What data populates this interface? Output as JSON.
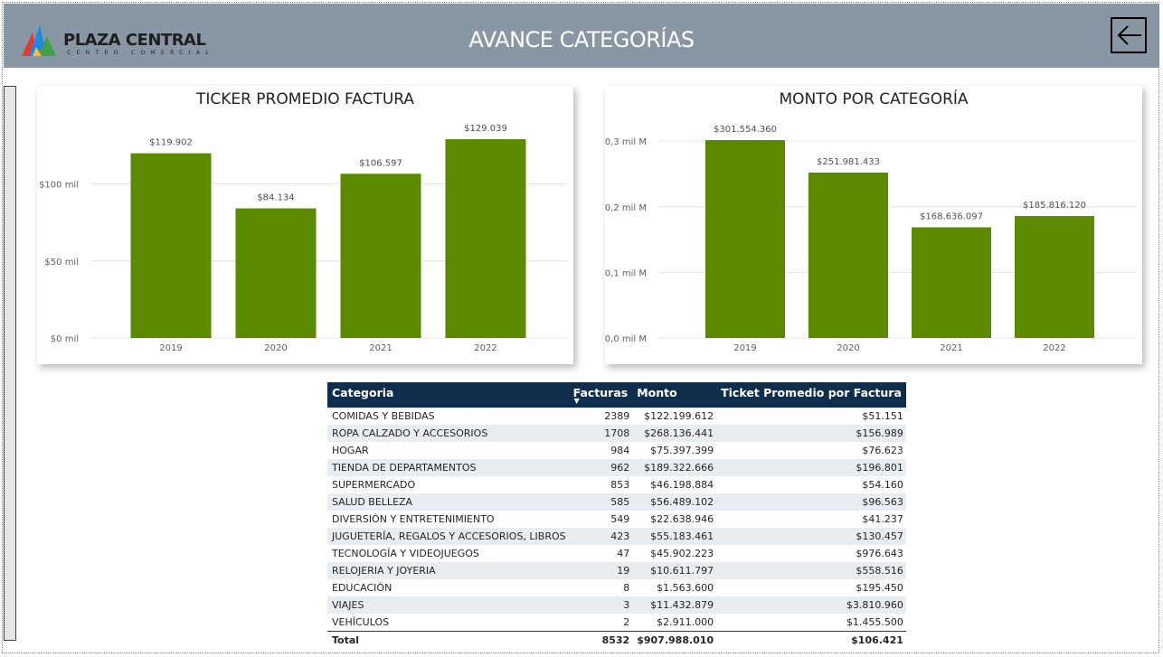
{
  "header": {
    "title": "AVANCE CATEGORÍAS",
    "logo": {
      "name": "PLAZA CENTRAL",
      "tagline": "CENTRO COMERCIAL",
      "colors": [
        "#e53935",
        "#1e88e5",
        "#43a047",
        "#fbc02d"
      ]
    },
    "back_icon": "arrow-left-icon"
  },
  "colors": {
    "header_bg": "#8996a3",
    "bar": "#5b8a00",
    "table_header": "#0f2d4d",
    "row_alt": "#e8edf1"
  },
  "chart_data": [
    {
      "type": "bar",
      "title": "TICKER PROMEDIO FACTURA",
      "categories": [
        "2019",
        "2020",
        "2021",
        "2022"
      ],
      "values": [
        119902,
        84134,
        106597,
        129039
      ],
      "data_labels": [
        "$119.902",
        "$84.134",
        "$106.597",
        "$129.039"
      ],
      "yticks": [
        {
          "value": 0,
          "label": "$0 mil"
        },
        {
          "value": 50000,
          "label": "$50 mil"
        },
        {
          "value": 100000,
          "label": "$100 mil"
        }
      ],
      "ylim": [
        0,
        129039
      ],
      "grid": true
    },
    {
      "type": "bar",
      "title": "MONTO POR CATEGORÍA",
      "categories": [
        "2019",
        "2020",
        "2021",
        "2022"
      ],
      "values": [
        301554360,
        251981433,
        168636097,
        185816120
      ],
      "data_labels": [
        "$301.554.360",
        "$251.981.433",
        "$168.636.097",
        "$185.816.120"
      ],
      "yticks": [
        {
          "value": 0,
          "label": "$0,0 mil M"
        },
        {
          "value": 100000000,
          "label": "$0,1 mil M"
        },
        {
          "value": 200000000,
          "label": "$0,2 mil M"
        },
        {
          "value": 300000000,
          "label": "$0,3 mil M"
        }
      ],
      "ylim": [
        0,
        301554360
      ],
      "grid": true
    }
  ],
  "table": {
    "columns": [
      "Categoria",
      "Facturas",
      "Monto",
      "Ticket Promedio por Factura"
    ],
    "rows": [
      [
        "COMIDAS Y BEBIDAS",
        "2389",
        "$122.199.612",
        "$51.151"
      ],
      [
        "ROPA CALZADO Y ACCESORIOS",
        "1708",
        "$268.136.441",
        "$156.989"
      ],
      [
        "HOGAR",
        "984",
        "$75.397.399",
        "$76.623"
      ],
      [
        "TIENDA DE DEPARTAMENTOS",
        "962",
        "$189.322.666",
        "$196.801"
      ],
      [
        "SUPERMERCADO",
        "853",
        "$46.198.884",
        "$54.160"
      ],
      [
        "SALUD BELLEZA",
        "585",
        "$56.489.102",
        "$96.563"
      ],
      [
        "DIVERSIÓN Y ENTRETENIMIENTO",
        "549",
        "$22.638.946",
        "$41.237"
      ],
      [
        "JUGUETERÍA, REGALOS Y ACCESORIOS, LIBROS",
        "423",
        "$55.183.461",
        "$130.457"
      ],
      [
        "TECNOLOGÍA Y VIDEOJUEGOS",
        "47",
        "$45.902.223",
        "$976.643"
      ],
      [
        "RELOJERIA Y JOYERIA",
        "19",
        "$10.611.797",
        "$558.516"
      ],
      [
        "EDUCACIÓN",
        "8",
        "$1.563.600",
        "$195.450"
      ],
      [
        "VIAJES",
        "3",
        "$11.432.879",
        "$3.810.960"
      ],
      [
        "VEHÍCULOS",
        "2",
        "$2.911.000",
        "$1.455.500"
      ]
    ],
    "total": [
      "Total",
      "8532",
      "$907.988.010",
      "$106.421"
    ],
    "sort_icon": "sort-descending-icon"
  }
}
